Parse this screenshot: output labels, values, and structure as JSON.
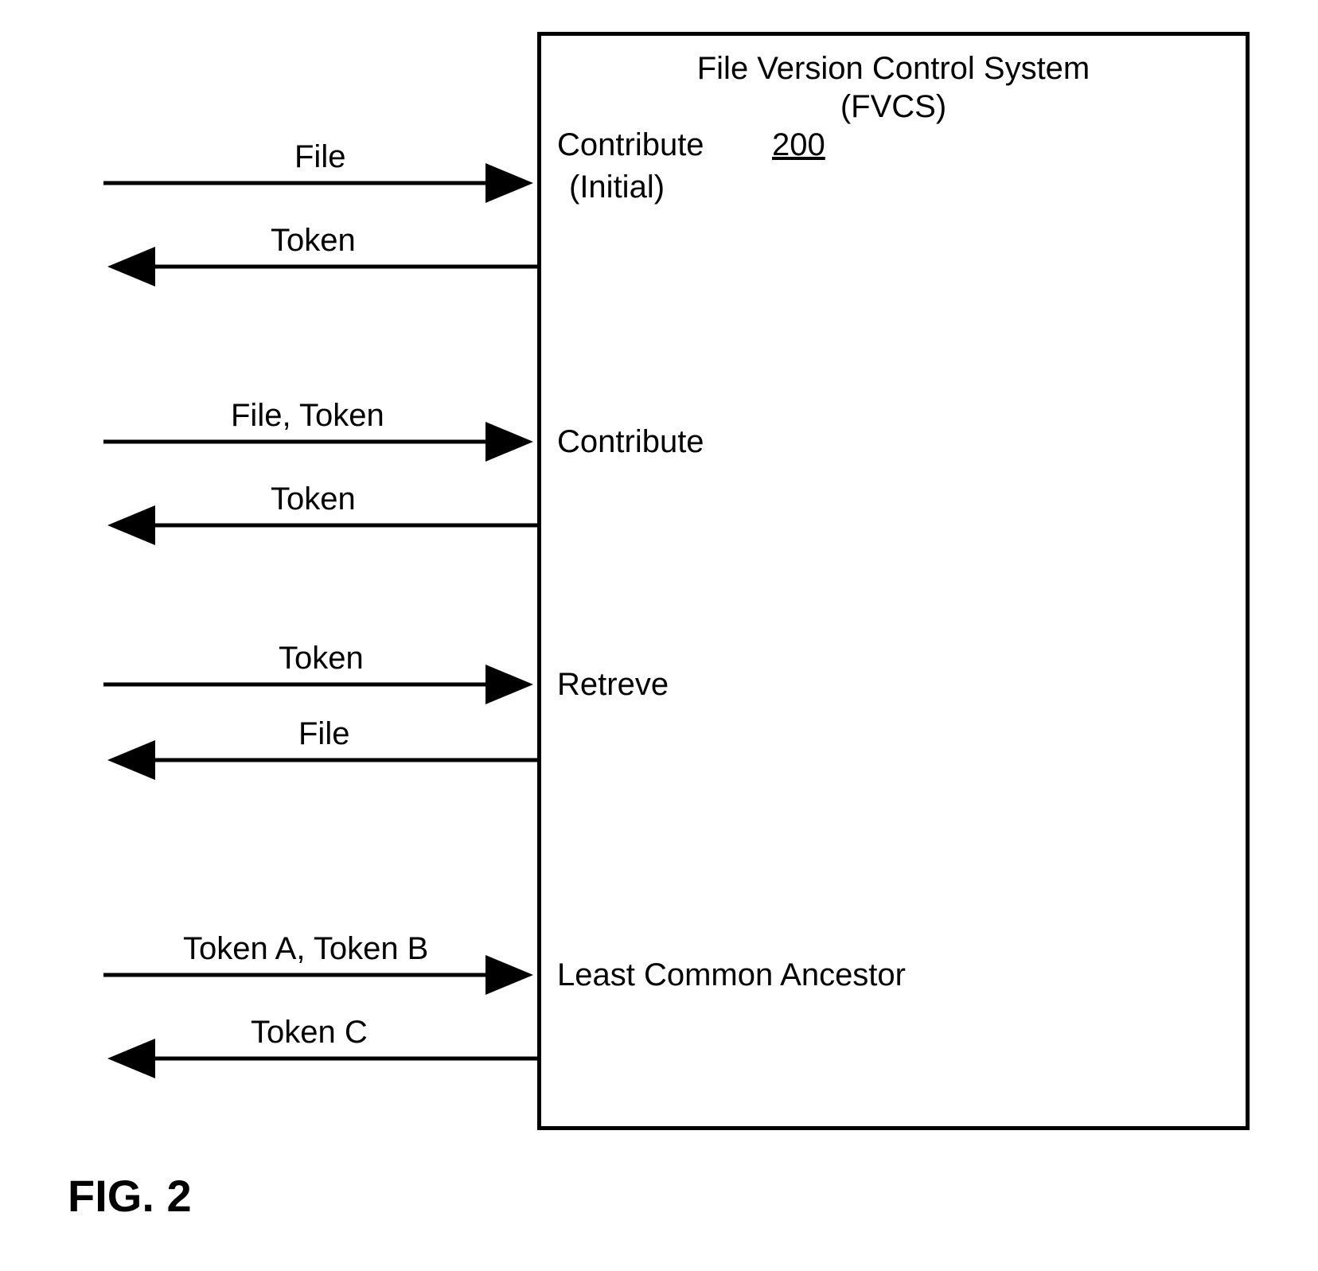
{
  "box": {
    "title_line1": "File Version Control System",
    "title_line2": "(FVCS)",
    "number": "200"
  },
  "operations": {
    "contribute_initial": {
      "label_line1": "Contribute",
      "label_line2": "(Initial)",
      "in_label": "File",
      "out_label": "Token"
    },
    "contribute": {
      "label": "Contribute",
      "in_label": "File, Token",
      "out_label": "Token"
    },
    "retrieve": {
      "label": "Retreve",
      "in_label": "Token",
      "out_label": "File"
    },
    "lca": {
      "label": "Least Common Ancestor",
      "in_label": "Token A, Token B",
      "out_label": "Token C"
    }
  },
  "figure": {
    "label": "FIG. 2"
  }
}
